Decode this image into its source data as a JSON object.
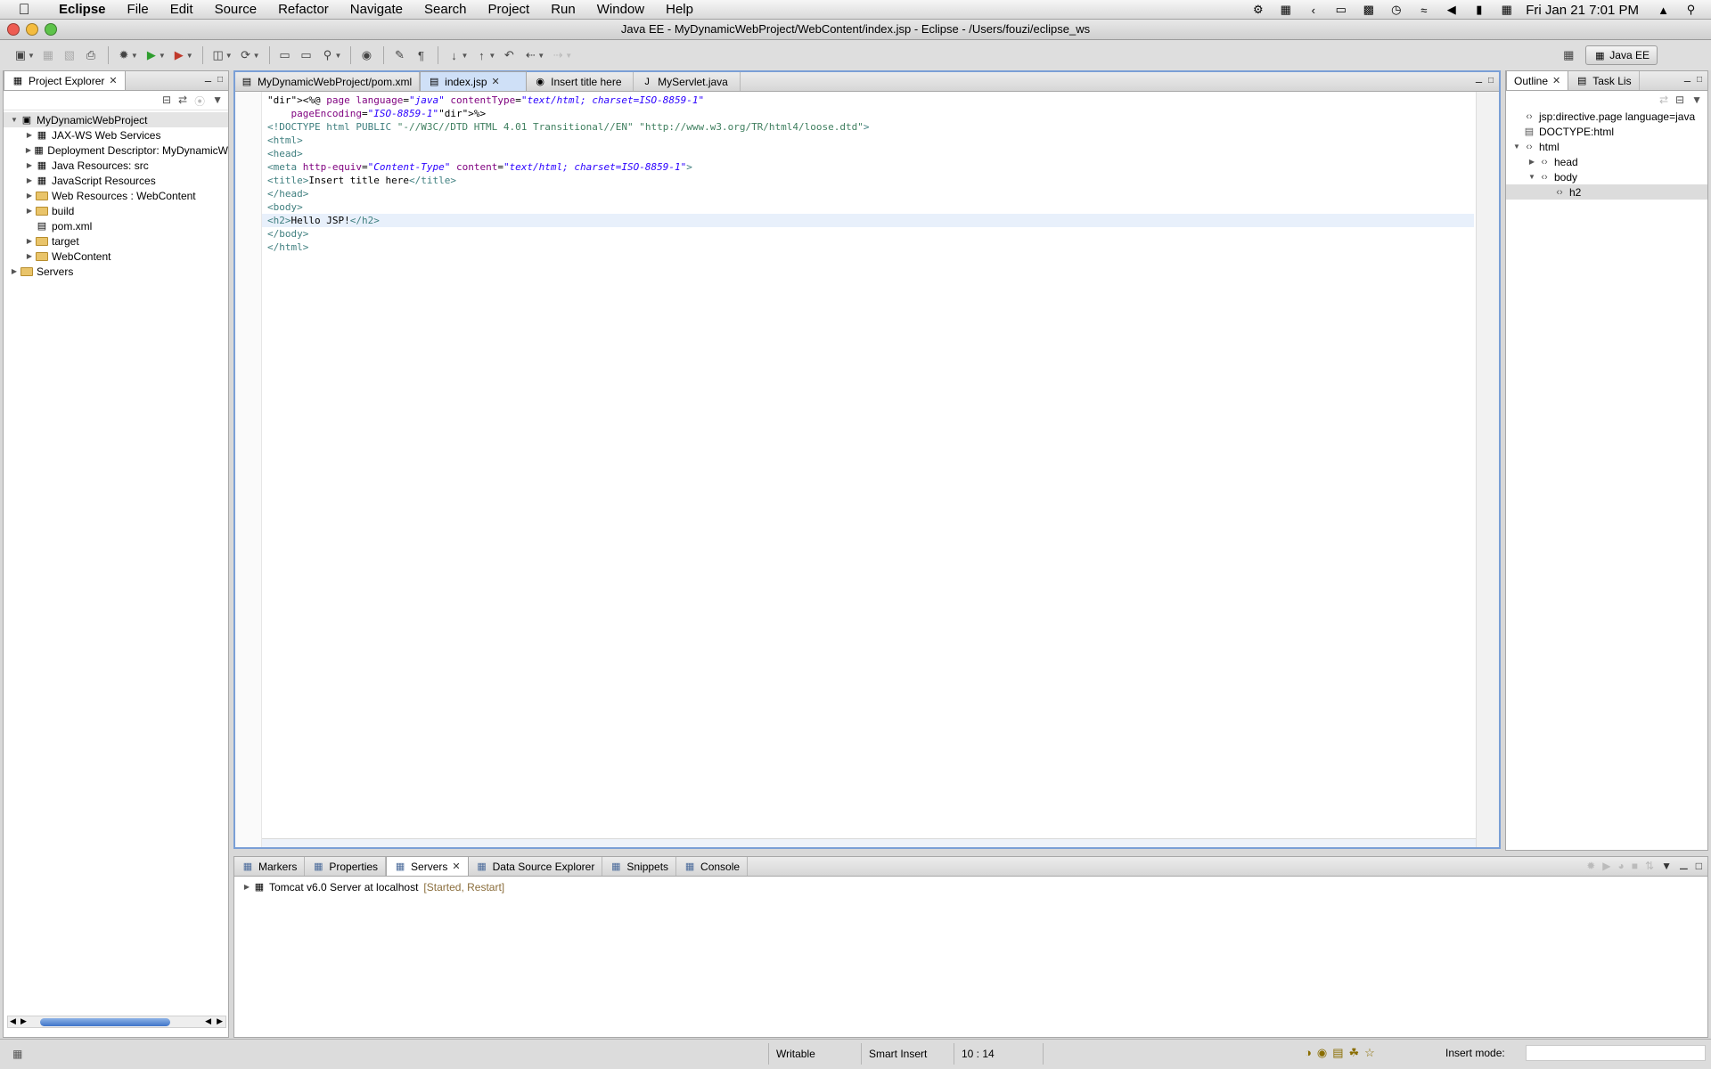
{
  "menubar": {
    "app_name": "Eclipse",
    "items": [
      "File",
      "Edit",
      "Source",
      "Refactor",
      "Navigate",
      "Search",
      "Project",
      "Run",
      "Window",
      "Help"
    ],
    "clock": "Fri Jan 21  7:01 PM"
  },
  "window": {
    "title": "Java EE - MyDynamicWebProject/WebContent/index.jsp - Eclipse - /Users/fouzi/eclipse_ws"
  },
  "toolbar": {
    "perspective_label": "Java EE"
  },
  "project_explorer": {
    "tab_label": "Project Explorer",
    "tree": [
      {
        "label": "MyDynamicWebProject",
        "level": 0,
        "state": "expanded",
        "icon": "project-icon"
      },
      {
        "label": "JAX-WS Web Services",
        "level": 1,
        "state": "collapsed",
        "icon": "webservice-icon"
      },
      {
        "label": "Deployment Descriptor: MyDynamicW",
        "level": 1,
        "state": "collapsed",
        "icon": "descriptor-icon"
      },
      {
        "label": "Java Resources: src",
        "level": 1,
        "state": "collapsed",
        "icon": "java-resources-icon"
      },
      {
        "label": "JavaScript Resources",
        "level": 1,
        "state": "collapsed",
        "icon": "javascript-icon"
      },
      {
        "label": "Web Resources : WebContent",
        "level": 1,
        "state": "collapsed",
        "icon": "folder-icon"
      },
      {
        "label": "build",
        "level": 1,
        "state": "collapsed",
        "icon": "folder-icon"
      },
      {
        "label": "pom.xml",
        "level": 1,
        "state": "leaf",
        "icon": "xml-file-icon"
      },
      {
        "label": "target",
        "level": 1,
        "state": "collapsed",
        "icon": "folder-icon"
      },
      {
        "label": "WebContent",
        "level": 1,
        "state": "collapsed",
        "icon": "folder-icon"
      },
      {
        "label": "Servers",
        "level": 0,
        "state": "collapsed",
        "icon": "folder-icon"
      }
    ]
  },
  "editor_tabs": [
    {
      "label": "MyDynamicWebProject/pom.xml",
      "active": false,
      "icon": "xml-file-icon"
    },
    {
      "label": "index.jsp",
      "active": true,
      "icon": "jsp-file-icon"
    },
    {
      "label": "Insert title here",
      "active": false,
      "icon": "globe-icon"
    },
    {
      "label": "MyServlet.java",
      "active": false,
      "icon": "java-file-icon"
    }
  ],
  "code_lines": [
    "<%@ page language=\"java\" contentType=\"text/html; charset=ISO-8859-1\"",
    "    pageEncoding=\"ISO-8859-1\"%>",
    "<!DOCTYPE html PUBLIC \"-//W3C//DTD HTML 4.01 Transitional//EN\" \"http://www.w3.org/TR/html4/loose.dtd\">",
    "<html>",
    "<head>",
    "<meta http-equiv=\"Content-Type\" content=\"text/html; charset=ISO-8859-1\">",
    "<title>Insert title here</title>",
    "</head>",
    "<body>",
    "<h2>Hello JSP!</h2>",
    "</body>",
    "</html>"
  ],
  "outline": {
    "tab_label": "Outline",
    "tab2_label": "Task Lis",
    "tree": [
      {
        "label": "jsp:directive.page language=java",
        "level": 0,
        "state": "leaf",
        "icon": "directive-icon"
      },
      {
        "label": "DOCTYPE:html",
        "level": 0,
        "state": "leaf",
        "icon": "doctype-icon"
      },
      {
        "label": "html",
        "level": 0,
        "state": "expanded",
        "icon": "element-icon"
      },
      {
        "label": "head",
        "level": 1,
        "state": "collapsed",
        "icon": "element-icon"
      },
      {
        "label": "body",
        "level": 1,
        "state": "expanded",
        "icon": "element-icon"
      },
      {
        "label": "h2",
        "level": 2,
        "state": "leaf",
        "icon": "element-icon",
        "selected": true
      }
    ]
  },
  "bottom_tabs": [
    {
      "label": "Markers",
      "active": false,
      "icon": "markers-icon"
    },
    {
      "label": "Properties",
      "active": false,
      "icon": "properties-icon"
    },
    {
      "label": "Servers",
      "active": true,
      "icon": "servers-icon"
    },
    {
      "label": "Data Source Explorer",
      "active": false,
      "icon": "database-icon"
    },
    {
      "label": "Snippets",
      "active": false,
      "icon": "snippets-icon"
    },
    {
      "label": "Console",
      "active": false,
      "icon": "console-icon"
    }
  ],
  "servers": {
    "name": "Tomcat v6.0 Server at localhost",
    "status": "[Started, Restart]"
  },
  "statusbar": {
    "writable": "Writable",
    "insert": "Smart Insert",
    "position": "10 : 14",
    "insert_mode_label": "Insert mode:"
  }
}
